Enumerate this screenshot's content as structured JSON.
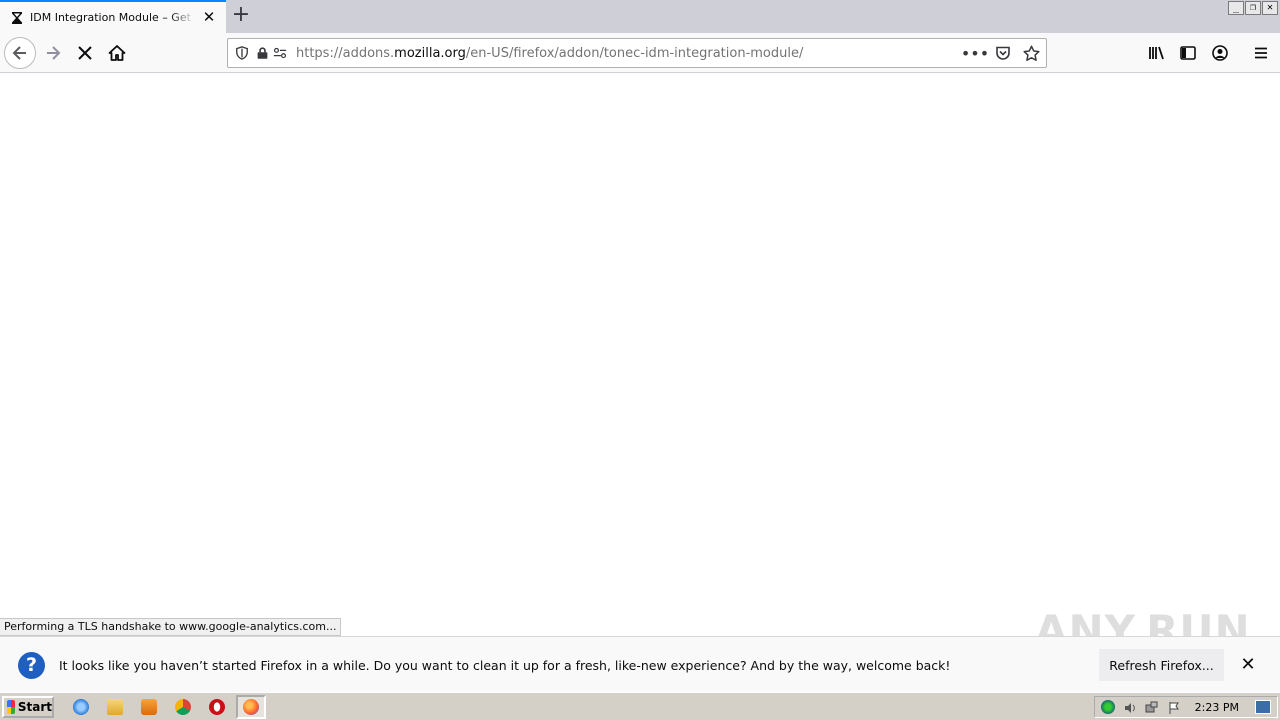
{
  "browser": {
    "tab": {
      "title": "IDM Integration Module – Get this",
      "favicon": "hourglass-icon"
    },
    "window_buttons": [
      "minimize-icon",
      "restore-icon",
      "close-icon"
    ],
    "url": {
      "prefix": "https://addons.",
      "domain": "mozilla.org",
      "path": "/en-US/firefox/addon/tonec-idm-integration-module/"
    },
    "status_text": "Performing a TLS handshake to www.google-analytics.com..."
  },
  "notification": {
    "message": "It looks like you haven’t started Firefox in a while. Do you want to clean it up for a fresh, like-new experience? And by the way, welcome back!",
    "button_label": "Refresh Firefox...",
    "icon": "question-icon"
  },
  "watermark": "ANY.RUN",
  "taskbar": {
    "start_label": "Start",
    "apps": [
      "internet-explorer-icon",
      "file-explorer-icon",
      "media-player-icon",
      "chrome-icon",
      "opera-icon",
      "firefox-icon"
    ],
    "clock": "2:23 PM"
  },
  "colors": {
    "accent": "#0a84ff",
    "notif_icon": "#1f5fbf",
    "taskbar": "#d4d0c8"
  }
}
